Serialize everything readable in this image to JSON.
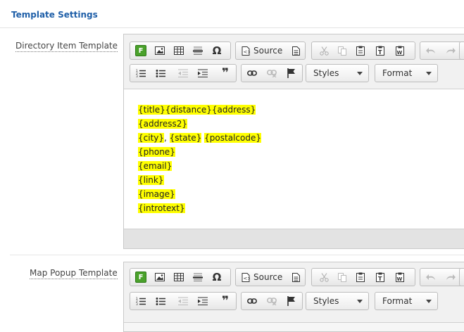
{
  "header": {
    "title": "Template Settings"
  },
  "labels": {
    "directory": "Directory Item Template",
    "popup": "Map Popup Template"
  },
  "toolbar": {
    "source_label": "Source",
    "styles_label": "Styles",
    "format_label": "Format",
    "omega": "Ω",
    "blockquote": "❞",
    "form_icon_letter": "F"
  },
  "editor1": {
    "lines": [
      [
        "{title}",
        "{distance}",
        "{address}"
      ],
      [
        "{address2}"
      ],
      [
        "{city}",
        ", ",
        "{state}",
        " ",
        "{postalcode}"
      ],
      [
        "{phone}"
      ],
      [
        "{email}"
      ],
      [
        "{link}"
      ],
      [
        "{image}"
      ],
      [
        "{introtext}"
      ]
    ],
    "l1a": "{title}",
    "l1b": "{distance}",
    "l1c": "{address}",
    "l2": "{address2}",
    "l3a": "{city}",
    "l3sep": ", ",
    "l3b": "{state}",
    "l3sp": " ",
    "l3c": "{postalcode}",
    "l4": "{phone}",
    "l5": "{email}",
    "l6": "{link}",
    "l7": "{image}",
    "l8": "{introtext}"
  },
  "colors": {
    "accent": "#1f5fa8",
    "highlight": "#ffff00",
    "form_icon": "#4aa12b"
  }
}
